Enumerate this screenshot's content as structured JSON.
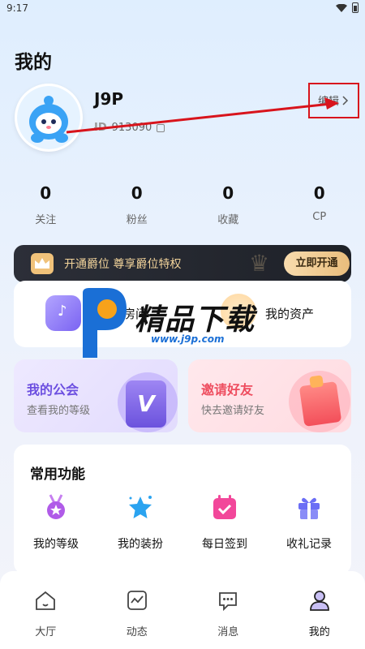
{
  "status_bar": {
    "time": "9:17"
  },
  "page": {
    "title": "我的"
  },
  "profile": {
    "username": "J9P",
    "id_label": "ID",
    "id_value": "913090",
    "edit_label": "编辑"
  },
  "stats": [
    {
      "value": "0",
      "label": "关注"
    },
    {
      "value": "0",
      "label": "粉丝"
    },
    {
      "value": "0",
      "label": "收藏"
    },
    {
      "value": "0",
      "label": "CP"
    }
  ],
  "vip": {
    "text": "开通爵位 尊享爵位特权",
    "button": "立即开通"
  },
  "shortcuts": {
    "room": "我的房间",
    "assets": "我的资产"
  },
  "watermark": {
    "text": "精品下载",
    "url": "www.j9p.com"
  },
  "guild": {
    "title": "我的公会",
    "subtitle": "查看我的等级"
  },
  "invite": {
    "title": "邀请好友",
    "subtitle": "快去邀请好友"
  },
  "functions": {
    "title": "常用功能",
    "items": [
      {
        "label": "我的等级",
        "icon": "medal-icon"
      },
      {
        "label": "我的装扮",
        "icon": "star-icon"
      },
      {
        "label": "每日签到",
        "icon": "calendar-check-icon"
      },
      {
        "label": "收礼记录",
        "icon": "gift-icon"
      }
    ]
  },
  "tabs": [
    {
      "label": "大厅",
      "icon": "home-icon"
    },
    {
      "label": "动态",
      "icon": "activity-icon"
    },
    {
      "label": "消息",
      "icon": "message-icon"
    },
    {
      "label": "我的",
      "icon": "profile-icon",
      "active": true
    }
  ],
  "colors": {
    "accent_purple": "#6c4fe0",
    "accent_pink": "#ee4d5f",
    "vip_gold": "#f3d49b",
    "annotation_red": "#d8141c"
  }
}
